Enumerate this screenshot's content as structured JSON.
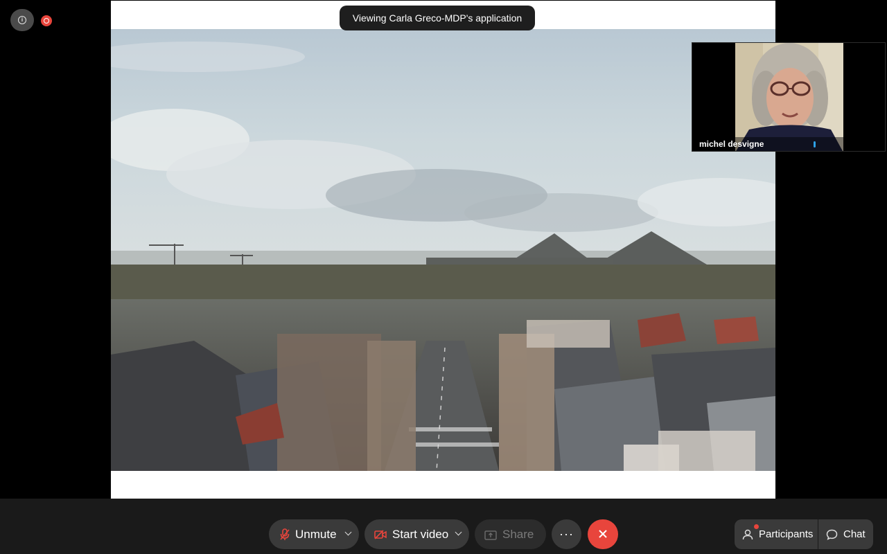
{
  "top_left": {
    "info_icon": "info-icon",
    "recording_icon": "recording-icon"
  },
  "share": {
    "banner": "Viewing Carla Greco-MDP's application"
  },
  "participant_tile": {
    "name": "michel desvigne",
    "mic_color": "#2ea0e6"
  },
  "toolbar": {
    "unmute_label": "Unmute",
    "start_video_label": "Start video",
    "share_label": "Share",
    "more_label": "···",
    "participants_label": "Participants",
    "chat_label": "Chat"
  },
  "colors": {
    "leave": "#e8453c",
    "button_bg": "#3a3a3a",
    "toolbar_bg": "#1a1a1a"
  }
}
